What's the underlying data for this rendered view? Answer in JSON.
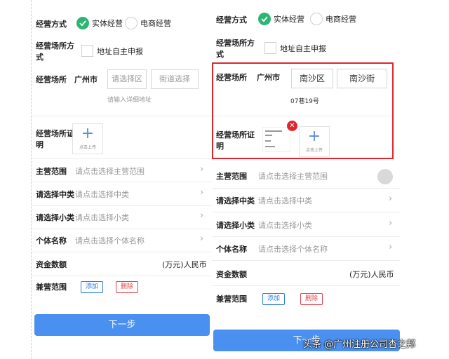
{
  "left": {
    "business_mode_label": "经营方式",
    "option_physical": "实体经营",
    "option_ecommerce": "电商经营",
    "premises_mode_label_1": "经营场所方",
    "premises_mode_label_2": "式",
    "self_declare_label": "地址自主申报",
    "premises_label": "经营场所",
    "city": "广州市",
    "district_placeholder": "请选择区",
    "street_placeholder": "街道选择",
    "address_placeholder": "请输入详细地址",
    "proof_label_1": "经营场所证",
    "proof_label_2": "明",
    "upload_caption": "点击上传",
    "main_scope_label": "主营范围",
    "main_scope_placeholder": "请点击选择主营范围",
    "mid_class_label": "请选择中类",
    "mid_class_placeholder": "请点击选择中类",
    "small_class_label": "请选择小类",
    "small_class_placeholder": "请点击选择小类",
    "entity_name_label": "个体名称",
    "entity_name_placeholder": "请点击选择个体名称",
    "capital_label": "资金数额",
    "capital_unit": "(万元)人民币",
    "side_scope_label": "兼营范围",
    "add_button": "添加",
    "delete_button": "删除",
    "next_button": "下一步"
  },
  "right": {
    "business_mode_label": "经营方式",
    "option_physical": "实体经营",
    "option_ecommerce": "电商经营",
    "premises_mode_label_1": "经营场所方",
    "premises_mode_label_2": "式",
    "self_declare_label": "地址自主申报",
    "premises_label": "经营场所",
    "city": "广州市",
    "district_value": "南沙区",
    "street_value": "南沙街",
    "address_value": "07巷19号",
    "proof_label_1": "经营场所证",
    "proof_label_2": "明",
    "upload_caption": "点击上传",
    "main_scope_label": "主营范围",
    "main_scope_placeholder": "请点击选择主营范围",
    "mid_class_label": "请选择中类",
    "mid_class_placeholder": "请点击选择中类",
    "small_class_label": "请选择小类",
    "small_class_placeholder": "请点击选择小类",
    "entity_name_label": "个体名称",
    "entity_name_placeholder": "请点击选择个体名称",
    "capital_label": "资金数额",
    "capital_unit": "(万元)人民币",
    "side_scope_label": "兼营范围",
    "add_button": "添加",
    "delete_button": "删除",
    "next_button": "下一步"
  },
  "watermark": "头条 @广州注册公司杳之邦",
  "colors": {
    "accent_green": "#2bb673",
    "primary_blue": "#4a90f0",
    "highlight_red": "#e0262c",
    "delete_red": "#e0454b"
  },
  "icons": [
    "check-icon",
    "plus-icon",
    "chevron-right-icon",
    "remove-x-icon"
  ]
}
